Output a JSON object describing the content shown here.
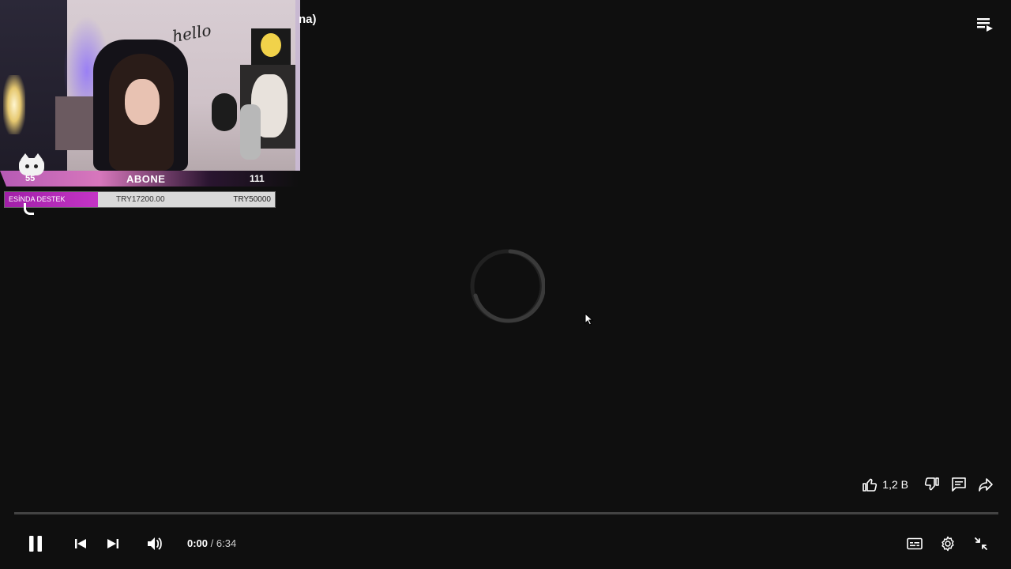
{
  "video": {
    "title_fragment": "na)",
    "time_current": "0:00",
    "time_separator": " / ",
    "duration": "6:34",
    "progress_fraction": 0.0
  },
  "overlay": {
    "sub_count": "55",
    "sub_label": "ABONE",
    "sub_goal": "111",
    "cam_sign": "hello",
    "donation": {
      "title": "ESİNDA DESTEK",
      "current": "TRY17200.00",
      "target": "TRY50000",
      "fraction": 0.344
    }
  },
  "actions": {
    "like_count": "1,2 B"
  },
  "icons": {
    "queue": "playlist-queue-icon",
    "like": "thumbs-up-icon",
    "dislike": "thumbs-down-icon",
    "comments": "comments-icon",
    "share": "share-icon",
    "pause": "pause-icon",
    "previous": "previous-icon",
    "next": "next-icon",
    "volume": "volume-icon",
    "captions": "captions-icon",
    "settings": "gear-icon",
    "exit_fullscreen": "exit-fullscreen-icon"
  },
  "colors": {
    "background": "#0f0f0f",
    "progress_played": "#ff0000",
    "donation_fill": "#b52bb8"
  }
}
